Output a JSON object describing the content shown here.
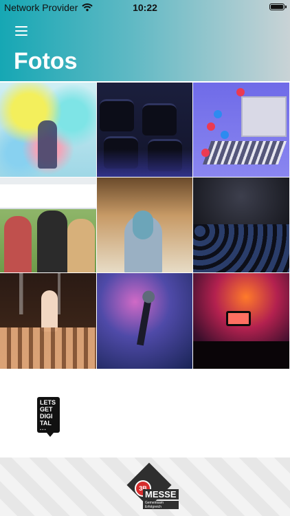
{
  "status_bar": {
    "carrier": "Network Provider",
    "time": "10:22",
    "battery_level": 1.0
  },
  "header": {
    "title": "Fotos",
    "menu_icon": "menu-icon"
  },
  "grid": {
    "photos": [
      "holi-color-festival-photo",
      "empty-auditorium-seats-photo",
      "livestream-stage-reactions-photo",
      "outdoor-festival-crowd-photo",
      "speaker-at-conference-photo",
      "audience-dark-venue-photo",
      "concert-singer-crowd-photo",
      "stage-microphone-lights-photo",
      "phone-recording-concert-photo"
    ]
  },
  "brand": {
    "lgd_logo": {
      "lines": [
        "LETS",
        "GET",
        "DIGI",
        "TAL"
      ],
      "dots": "..."
    }
  },
  "footer": {
    "logo": {
      "badge": "3B",
      "word": "MESSE",
      "tagline": "Gemeinsam Erfolgreich"
    }
  },
  "colors": {
    "header_gradient_start": "#16a7b4",
    "header_gradient_end": "#c9d3d6",
    "title_text": "#ffffff",
    "logo_dark": "#2f2f2f",
    "logo_red": "#d62d2d"
  }
}
